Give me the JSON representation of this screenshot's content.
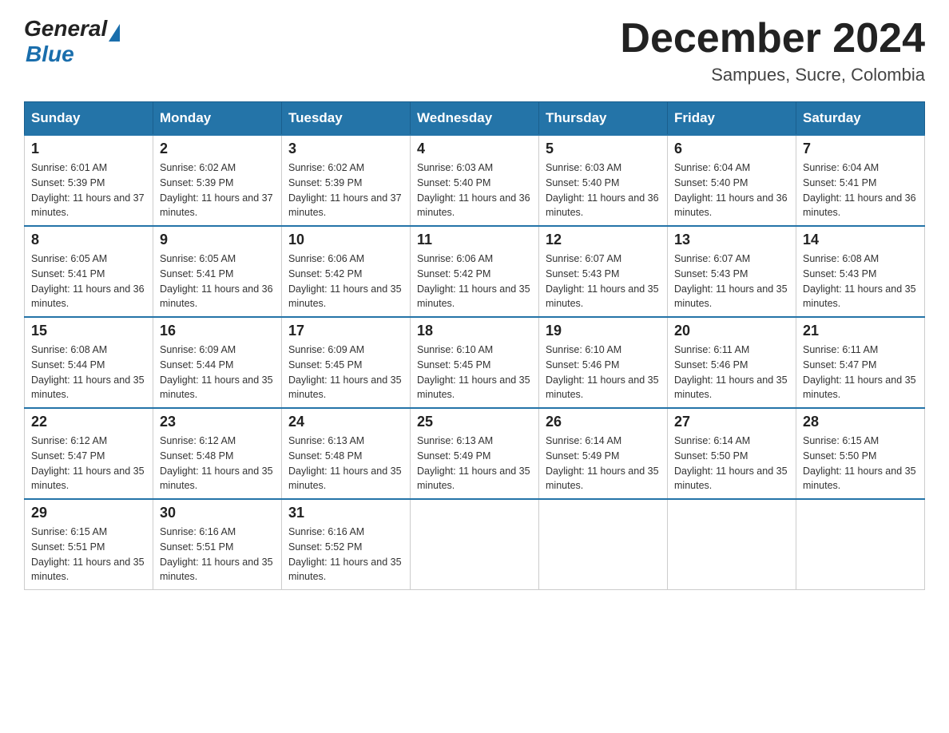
{
  "header": {
    "logo_general": "General",
    "logo_blue": "Blue",
    "month_title": "December 2024",
    "location": "Sampues, Sucre, Colombia"
  },
  "days_of_week": [
    "Sunday",
    "Monday",
    "Tuesday",
    "Wednesday",
    "Thursday",
    "Friday",
    "Saturday"
  ],
  "weeks": [
    [
      {
        "day": "1",
        "sunrise": "6:01 AM",
        "sunset": "5:39 PM",
        "daylight": "11 hours and 37 minutes."
      },
      {
        "day": "2",
        "sunrise": "6:02 AM",
        "sunset": "5:39 PM",
        "daylight": "11 hours and 37 minutes."
      },
      {
        "day": "3",
        "sunrise": "6:02 AM",
        "sunset": "5:39 PM",
        "daylight": "11 hours and 37 minutes."
      },
      {
        "day": "4",
        "sunrise": "6:03 AM",
        "sunset": "5:40 PM",
        "daylight": "11 hours and 36 minutes."
      },
      {
        "day": "5",
        "sunrise": "6:03 AM",
        "sunset": "5:40 PM",
        "daylight": "11 hours and 36 minutes."
      },
      {
        "day": "6",
        "sunrise": "6:04 AM",
        "sunset": "5:40 PM",
        "daylight": "11 hours and 36 minutes."
      },
      {
        "day": "7",
        "sunrise": "6:04 AM",
        "sunset": "5:41 PM",
        "daylight": "11 hours and 36 minutes."
      }
    ],
    [
      {
        "day": "8",
        "sunrise": "6:05 AM",
        "sunset": "5:41 PM",
        "daylight": "11 hours and 36 minutes."
      },
      {
        "day": "9",
        "sunrise": "6:05 AM",
        "sunset": "5:41 PM",
        "daylight": "11 hours and 36 minutes."
      },
      {
        "day": "10",
        "sunrise": "6:06 AM",
        "sunset": "5:42 PM",
        "daylight": "11 hours and 35 minutes."
      },
      {
        "day": "11",
        "sunrise": "6:06 AM",
        "sunset": "5:42 PM",
        "daylight": "11 hours and 35 minutes."
      },
      {
        "day": "12",
        "sunrise": "6:07 AM",
        "sunset": "5:43 PM",
        "daylight": "11 hours and 35 minutes."
      },
      {
        "day": "13",
        "sunrise": "6:07 AM",
        "sunset": "5:43 PM",
        "daylight": "11 hours and 35 minutes."
      },
      {
        "day": "14",
        "sunrise": "6:08 AM",
        "sunset": "5:43 PM",
        "daylight": "11 hours and 35 minutes."
      }
    ],
    [
      {
        "day": "15",
        "sunrise": "6:08 AM",
        "sunset": "5:44 PM",
        "daylight": "11 hours and 35 minutes."
      },
      {
        "day": "16",
        "sunrise": "6:09 AM",
        "sunset": "5:44 PM",
        "daylight": "11 hours and 35 minutes."
      },
      {
        "day": "17",
        "sunrise": "6:09 AM",
        "sunset": "5:45 PM",
        "daylight": "11 hours and 35 minutes."
      },
      {
        "day": "18",
        "sunrise": "6:10 AM",
        "sunset": "5:45 PM",
        "daylight": "11 hours and 35 minutes."
      },
      {
        "day": "19",
        "sunrise": "6:10 AM",
        "sunset": "5:46 PM",
        "daylight": "11 hours and 35 minutes."
      },
      {
        "day": "20",
        "sunrise": "6:11 AM",
        "sunset": "5:46 PM",
        "daylight": "11 hours and 35 minutes."
      },
      {
        "day": "21",
        "sunrise": "6:11 AM",
        "sunset": "5:47 PM",
        "daylight": "11 hours and 35 minutes."
      }
    ],
    [
      {
        "day": "22",
        "sunrise": "6:12 AM",
        "sunset": "5:47 PM",
        "daylight": "11 hours and 35 minutes."
      },
      {
        "day": "23",
        "sunrise": "6:12 AM",
        "sunset": "5:48 PM",
        "daylight": "11 hours and 35 minutes."
      },
      {
        "day": "24",
        "sunrise": "6:13 AM",
        "sunset": "5:48 PM",
        "daylight": "11 hours and 35 minutes."
      },
      {
        "day": "25",
        "sunrise": "6:13 AM",
        "sunset": "5:49 PM",
        "daylight": "11 hours and 35 minutes."
      },
      {
        "day": "26",
        "sunrise": "6:14 AM",
        "sunset": "5:49 PM",
        "daylight": "11 hours and 35 minutes."
      },
      {
        "day": "27",
        "sunrise": "6:14 AM",
        "sunset": "5:50 PM",
        "daylight": "11 hours and 35 minutes."
      },
      {
        "day": "28",
        "sunrise": "6:15 AM",
        "sunset": "5:50 PM",
        "daylight": "11 hours and 35 minutes."
      }
    ],
    [
      {
        "day": "29",
        "sunrise": "6:15 AM",
        "sunset": "5:51 PM",
        "daylight": "11 hours and 35 minutes."
      },
      {
        "day": "30",
        "sunrise": "6:16 AM",
        "sunset": "5:51 PM",
        "daylight": "11 hours and 35 minutes."
      },
      {
        "day": "31",
        "sunrise": "6:16 AM",
        "sunset": "5:52 PM",
        "daylight": "11 hours and 35 minutes."
      },
      null,
      null,
      null,
      null
    ]
  ]
}
